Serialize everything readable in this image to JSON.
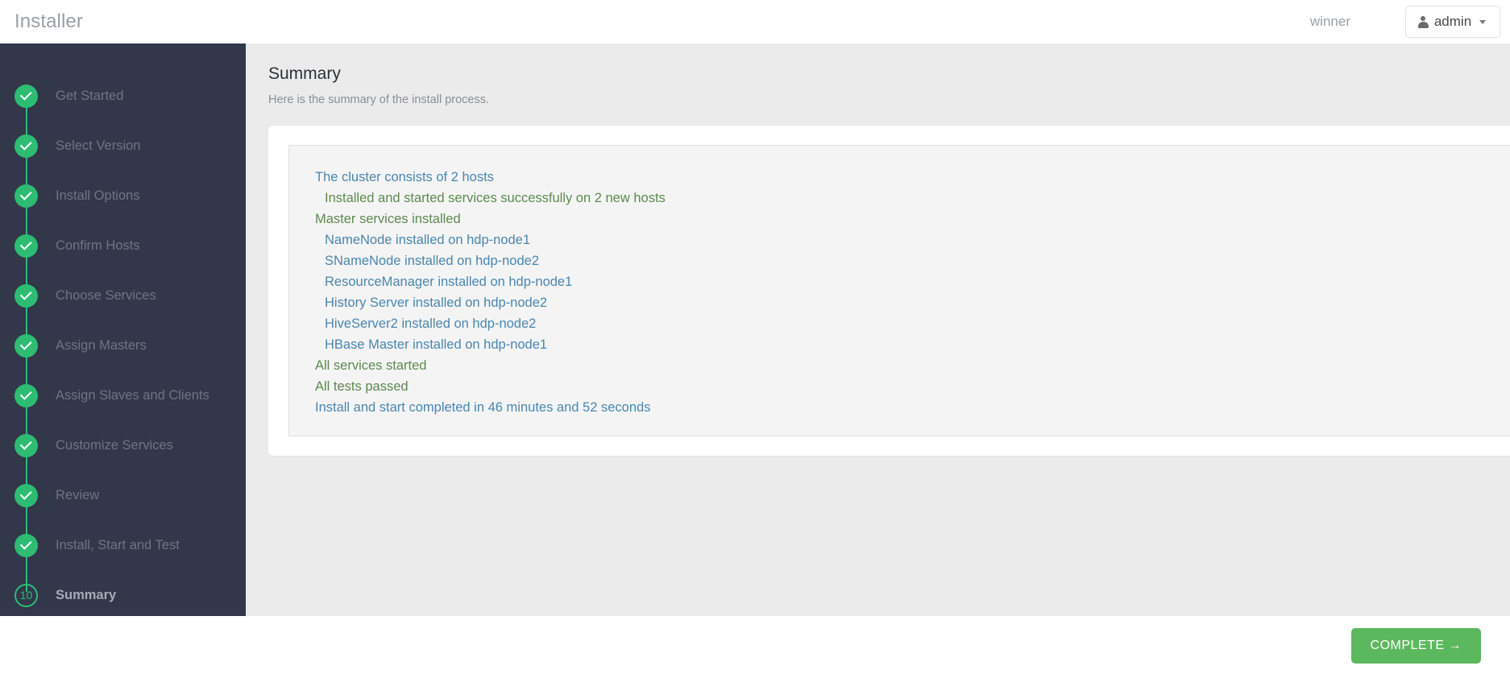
{
  "header": {
    "brand": "Installer",
    "cluster_name": "winner",
    "user_menu": {
      "label": "admin",
      "icon": "person-icon",
      "caret": "chevron-down-icon"
    }
  },
  "sidebar": {
    "steps": [
      {
        "label": "Get Started",
        "state": "done",
        "marker": "check"
      },
      {
        "label": "Select Version",
        "state": "done",
        "marker": "check"
      },
      {
        "label": "Install Options",
        "state": "done",
        "marker": "check"
      },
      {
        "label": "Confirm Hosts",
        "state": "done",
        "marker": "check"
      },
      {
        "label": "Choose Services",
        "state": "done",
        "marker": "check"
      },
      {
        "label": "Assign Masters",
        "state": "done",
        "marker": "check"
      },
      {
        "label": "Assign Slaves and Clients",
        "state": "done",
        "marker": "check"
      },
      {
        "label": "Customize Services",
        "state": "done",
        "marker": "check"
      },
      {
        "label": "Review",
        "state": "done",
        "marker": "check"
      },
      {
        "label": "Install, Start and Test",
        "state": "done",
        "marker": "check"
      },
      {
        "label": "Summary",
        "state": "active",
        "marker": "10"
      }
    ]
  },
  "main": {
    "title": "Summary",
    "subtitle": "Here is the summary of the install process.",
    "summary_lines": [
      {
        "text": "The cluster consists of 2 hosts",
        "level": 0,
        "color": "blue"
      },
      {
        "text": "Installed and started services successfully on 2 new hosts",
        "level": 1,
        "color": "green"
      },
      {
        "text": "Master services installed",
        "level": 0,
        "color": "green"
      },
      {
        "text": "NameNode installed on hdp-node1",
        "level": 1,
        "color": "blue"
      },
      {
        "text": "SNameNode installed on hdp-node2",
        "level": 1,
        "color": "blue"
      },
      {
        "text": "ResourceManager installed on hdp-node1",
        "level": 1,
        "color": "blue"
      },
      {
        "text": "History Server installed on hdp-node2",
        "level": 1,
        "color": "blue"
      },
      {
        "text": "HiveServer2 installed on hdp-node2",
        "level": 1,
        "color": "blue"
      },
      {
        "text": "HBase Master installed on hdp-node1",
        "level": 1,
        "color": "blue"
      },
      {
        "text": "All services started",
        "level": 0,
        "color": "green"
      },
      {
        "text": "All tests passed",
        "level": 0,
        "color": "green"
      },
      {
        "text": "Install and start completed in 46 minutes and 52 seconds",
        "level": 0,
        "color": "blue"
      }
    ]
  },
  "footer": {
    "complete_label": "COMPLETE →"
  },
  "colors": {
    "accent_green": "#2dbc72",
    "button_green": "#5cb85c",
    "sidebar_bg": "#32374a",
    "content_bg": "#ebebeb",
    "line_blue": "#4a87ad",
    "line_green": "#5d8a4e"
  }
}
